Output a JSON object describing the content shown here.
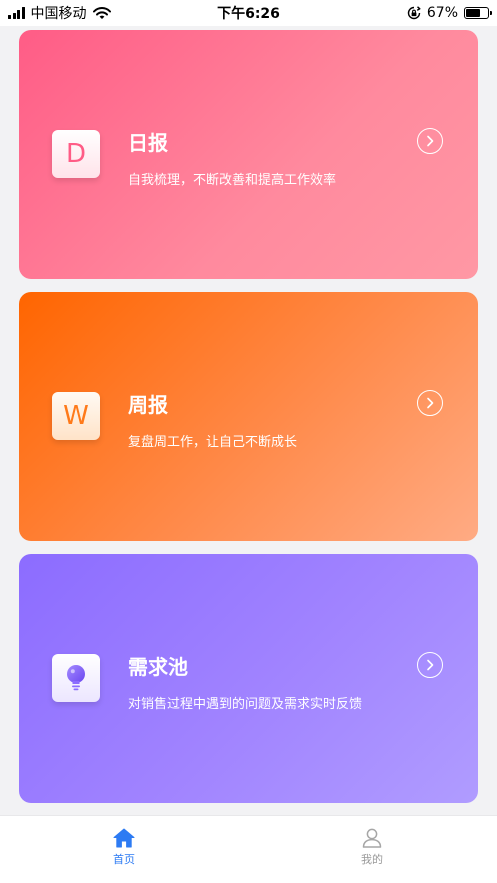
{
  "status_bar": {
    "carrier": "中国移动",
    "time": "下午6:26",
    "battery_percent": "67%",
    "battery_level": 0.67
  },
  "cards": [
    {
      "icon_letter": "D",
      "title": "日报",
      "subtitle": "自我梳理，不断改善和提高工作效率",
      "gradient": [
        "#ff5c86",
        "#ff98a4"
      ]
    },
    {
      "icon_letter": "W",
      "title": "周报",
      "subtitle": "复盘周工作，让自己不断成长",
      "gradient": [
        "#ff6500",
        "#ffab84"
      ]
    },
    {
      "icon": "lightbulb-icon",
      "title": "需求池",
      "subtitle": "对销售过程中遇到的问题及需求实时反馈",
      "gradient": [
        "#8c6cff",
        "#b09cff"
      ]
    }
  ],
  "tab_bar": {
    "active_color": "#2d7bf3",
    "inactive_color": "#999999",
    "tabs": [
      {
        "label": "首页",
        "icon": "home-icon",
        "active": true
      },
      {
        "label": "我的",
        "icon": "user-icon",
        "active": false
      }
    ]
  }
}
